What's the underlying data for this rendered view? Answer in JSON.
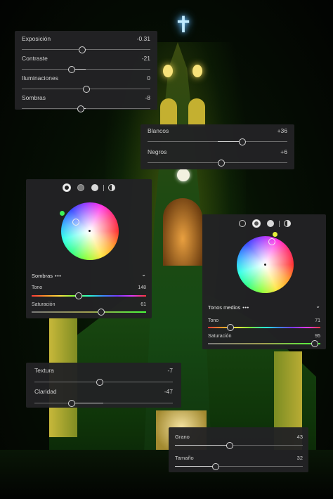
{
  "basic": {
    "exposure": {
      "label": "Exposición",
      "value": "-0.31",
      "level": 0.47
    },
    "contrast": {
      "label": "Contraste",
      "value": "-21",
      "level": 0.39
    },
    "highlights": {
      "label": "Iluminaciones",
      "value": "0",
      "level": 0.5
    },
    "shadows": {
      "label": "Sombras",
      "value": "-8",
      "level": 0.46
    }
  },
  "tone": {
    "whites": {
      "label": "Blancos",
      "value": "+36",
      "level": 0.68
    },
    "blacks": {
      "label": "Negros",
      "value": "+6",
      "level": 0.53
    }
  },
  "grading_shadows": {
    "section": "Sombras",
    "more": "•••",
    "hue_label": "Tono",
    "hue_value": "148",
    "hue_level": 0.41,
    "sat_label": "Saturación",
    "sat_value": "61",
    "sat_level": 0.61
  },
  "grading_midtones": {
    "section": "Tonos medios",
    "more": "•••",
    "hue_label": "Tono",
    "hue_value": "71",
    "hue_level": 0.2,
    "sat_label": "Saturación",
    "sat_value": "95",
    "sat_level": 0.95
  },
  "detail": {
    "texture": {
      "label": "Textura",
      "value": "-7",
      "level": 0.47
    },
    "clarity": {
      "label": "Claridad",
      "value": "-47",
      "level": 0.27
    }
  },
  "grain": {
    "amount": {
      "label": "Grano",
      "value": "43",
      "level": 0.43
    },
    "size": {
      "label": "Tamaño",
      "value": "32",
      "level": 0.32
    }
  },
  "colors": {
    "panel": "#222224",
    "shadow_pin": "#3df05a",
    "midtone_pin": "#e4f03a"
  },
  "icons": [
    "cross-icon",
    "chevron-down-icon",
    "more-icon",
    "mode-circle-icon",
    "split-circle-icon"
  ]
}
